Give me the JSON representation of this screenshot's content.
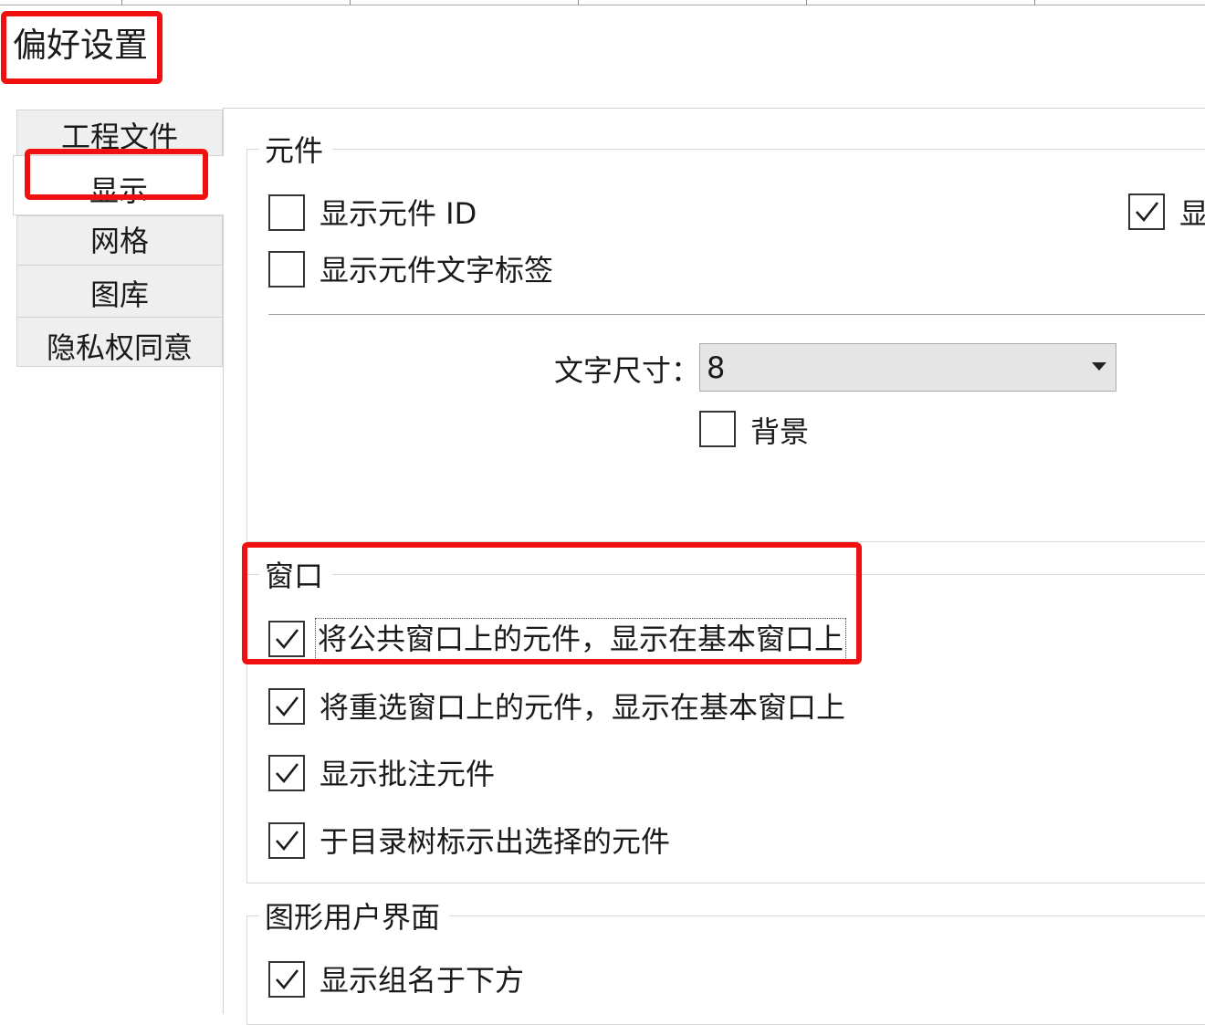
{
  "window": {
    "title": "偏好设置"
  },
  "tabs": [
    {
      "label": "工程文件"
    },
    {
      "label": "显示"
    },
    {
      "label": "网格"
    },
    {
      "label": "图库"
    },
    {
      "label": "隐私权同意"
    }
  ],
  "components_group": {
    "legend": "元件",
    "show_id": {
      "label": "显示元件 ID",
      "checked": false
    },
    "show_label": {
      "label": "显示元件文字标签",
      "checked": false
    },
    "right_option": {
      "label": "显",
      "checked": true
    },
    "font_size": {
      "label": "文字尺寸：",
      "value": "8"
    },
    "background": {
      "label": "背景",
      "checked": false
    }
  },
  "window_group": {
    "legend": "窗口",
    "items": [
      {
        "label": "将公共窗口上的元件，显示在基本窗口上",
        "checked": true
      },
      {
        "label": "将重选窗口上的元件，显示在基本窗口上",
        "checked": true
      },
      {
        "label": "显示批注元件",
        "checked": true
      },
      {
        "label": "于目录树标示出选择的元件",
        "checked": true
      }
    ]
  },
  "gui_group": {
    "legend": "图形用户界面",
    "items": [
      {
        "label": "显示组名于下方",
        "checked": true
      }
    ]
  },
  "colors": {
    "highlight": "#f01010",
    "tab_bg": "#efefef",
    "select_bg": "#e5e5e5"
  }
}
